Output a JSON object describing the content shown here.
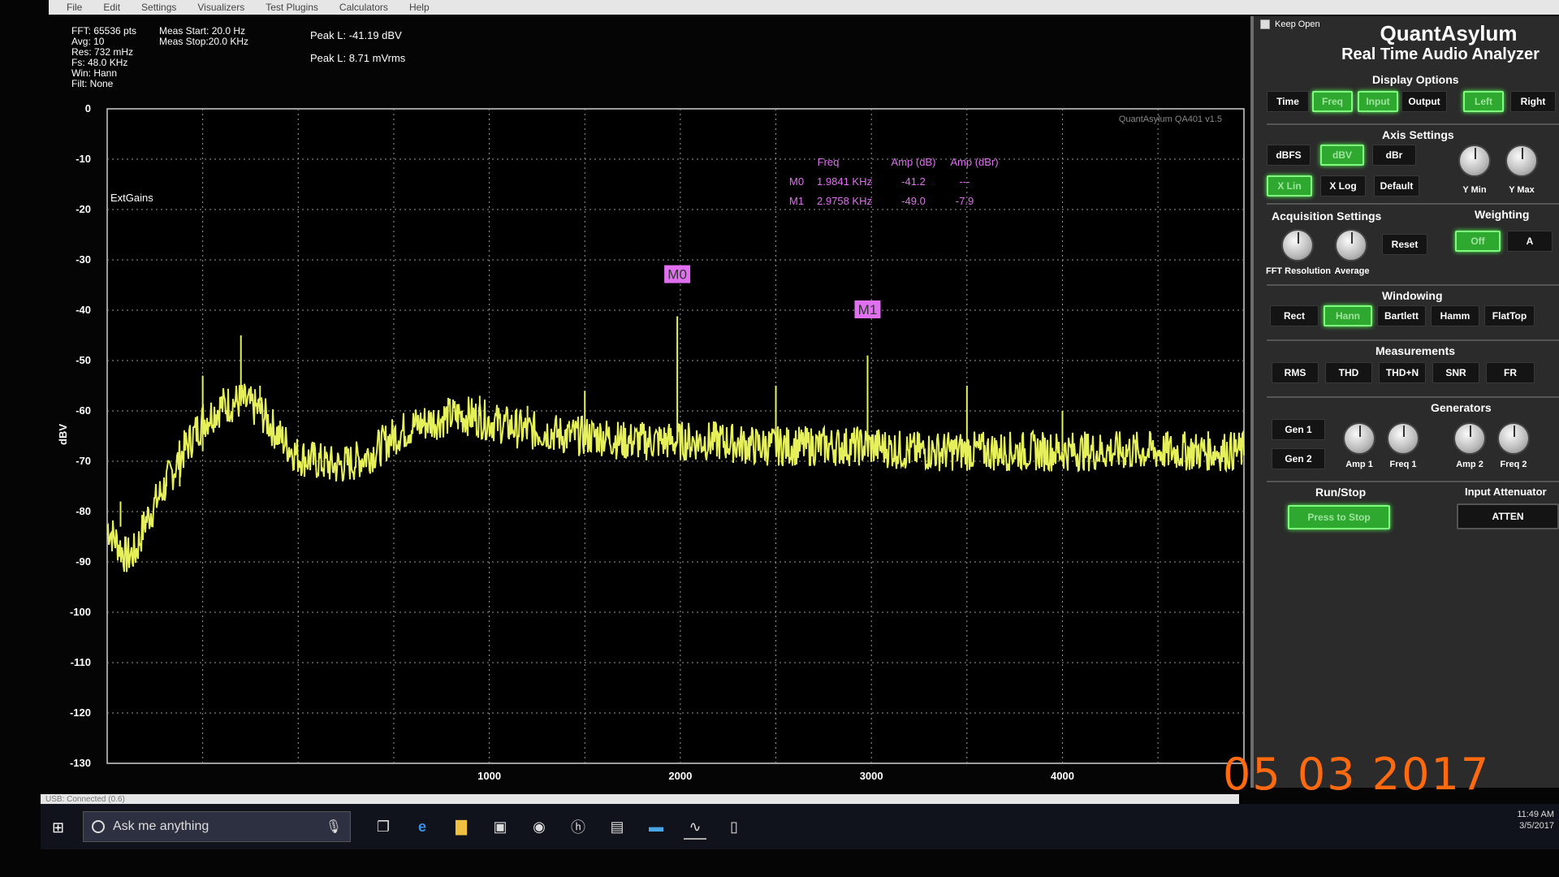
{
  "menu": [
    "File",
    "Edit",
    "Settings",
    "Visualizers",
    "Test Plugins",
    "Calculators",
    "Help"
  ],
  "readouts": {
    "info_lines": [
      "FFT: 65536 pts",
      "Avg: 10",
      "Res: 732 mHz",
      "Fs: 48.0 KHz",
      "Win: Hann",
      "Filt: None"
    ],
    "meas_start": "Meas Start: 20.0 Hz",
    "meas_stop": "Meas Stop:20.0 KHz",
    "peak_dbv": "Peak L: -41.19 dBV",
    "peak_mvrms": "Peak L: 8.71 mVrms"
  },
  "chart_data": {
    "type": "line",
    "ylabel": "dBV",
    "ylim": [
      -130,
      0
    ],
    "xlim": [
      -1000,
      4000
    ],
    "y_ticks": [
      0,
      -10,
      -20,
      -30,
      -40,
      -50,
      -60,
      -70,
      -80,
      -90,
      -100,
      -110,
      -120,
      -130
    ],
    "x_ticks": [
      1000,
      2000,
      3000,
      4000
    ],
    "watermark": "QuantAsylum QA401 v1.5",
    "ext_label": "ExtGains",
    "trace_color": "#e6f05a",
    "grid": true,
    "series": [
      {
        "x": [
          -1000,
          -900,
          -850,
          -800,
          -700,
          -600,
          -500,
          -400,
          -300,
          -200,
          -100,
          0,
          100,
          200,
          300,
          400,
          500,
          600,
          700,
          800,
          900,
          1000,
          1100,
          1200,
          1300,
          1400,
          1500,
          1600,
          1700,
          1800,
          1900,
          2000,
          2200,
          2400,
          2600,
          2800,
          3000,
          3200,
          3400,
          3600,
          3800,
          4000,
          4200,
          4400
        ],
        "values": [
          -83,
          -89,
          -88,
          -82,
          -75,
          -68,
          -62,
          -59,
          -58,
          -60,
          -65,
          -69,
          -70,
          -71,
          -70,
          -68,
          -65,
          -63,
          -62,
          -61,
          -61,
          -62,
          -63,
          -64,
          -64,
          -65,
          -65,
          -65,
          -66,
          -66,
          -66,
          -66,
          -66,
          -67,
          -67,
          -67,
          -67,
          -68,
          -68,
          -68,
          -68,
          -68,
          -68,
          -68
        ]
      }
    ],
    "spikes": [
      {
        "x": -930,
        "top": -78
      },
      {
        "x": -620,
        "top": -68
      },
      {
        "x": -690,
        "top": -73
      },
      {
        "x": -500,
        "top": -53
      },
      {
        "x": -300,
        "top": -45
      },
      {
        "x": -200,
        "top": -55
      },
      {
        "x": 950,
        "top": -57
      },
      {
        "x": 1200,
        "top": -59
      },
      {
        "x": 1984,
        "top": -41.2
      },
      {
        "x": 2980,
        "top": -49
      },
      {
        "x": 1500,
        "top": -56
      },
      {
        "x": 2500,
        "top": -55
      },
      {
        "x": 3500,
        "top": -55
      },
      {
        "x": 4000,
        "top": -60
      }
    ],
    "markers": [
      {
        "label": "M0",
        "x": 1984,
        "y": -33
      },
      {
        "label": "M1",
        "x": 2980,
        "y": -40
      }
    ],
    "marker_table": {
      "headers": [
        "Freq",
        "Amp (dB)",
        "Amp (dBr)"
      ],
      "rows": [
        {
          "name": "M0",
          "freq": "1.9841 KHz",
          "amp": "-41.2",
          "ampr": "---"
        },
        {
          "name": "M1",
          "freq": "2.9758 KHz",
          "amp": "-49.0",
          "ampr": "-7.9"
        }
      ]
    }
  },
  "panel": {
    "keep_open": "Keep Open",
    "title1": "QuantAsylum",
    "title2": "Real Time Audio Analyzer",
    "display_options": {
      "title": "Display Options",
      "buttons": [
        "Time",
        "Freq",
        "Input",
        "Output",
        "Left",
        "Right"
      ]
    },
    "axis_settings": {
      "title": "Axis Settings",
      "buttons": [
        "dBFS",
        "dBV",
        "dBr",
        "X Lin",
        "X Log",
        "Default"
      ],
      "knobs": [
        "Y Min",
        "Y Max"
      ]
    },
    "acquisition": {
      "title": "Acquisition Settings",
      "knobs": [
        "FFT Resolution",
        "Average"
      ],
      "reset": "Reset"
    },
    "weighting": {
      "title": "Weighting",
      "buttons": [
        "Off",
        "A"
      ]
    },
    "windowing": {
      "title": "Windowing",
      "buttons": [
        "Rect",
        "Hann",
        "Bartlett",
        "Hamm",
        "FlatTop"
      ]
    },
    "measurements": {
      "title": "Measurements",
      "buttons": [
        "RMS",
        "THD",
        "THD+N",
        "SNR",
        "FR"
      ]
    },
    "generators": {
      "title": "Generators",
      "buttons": [
        "Gen 1",
        "Gen 2"
      ],
      "knobs": [
        "Amp 1",
        "Freq 1",
        "Amp 2",
        "Freq 2"
      ]
    },
    "runstop": {
      "title": "Run/Stop",
      "button": "Press to Stop"
    },
    "attenuator": {
      "title": "Input Attenuator",
      "button": "ATTEN"
    }
  },
  "status_text": "USB: Connected  (0.6)",
  "date_stamp": "05 03 2017",
  "taskbar": {
    "search_placeholder": "Ask me anything",
    "time": "11:49 AM",
    "date": "3/5/2017"
  }
}
